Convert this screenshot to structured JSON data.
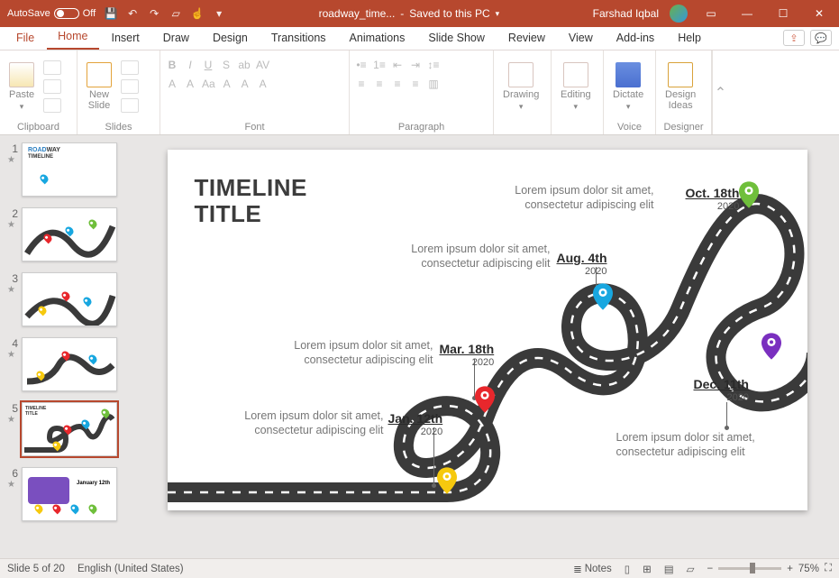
{
  "titlebar": {
    "autosave_label": "AutoSave",
    "autosave_state": "Off",
    "filename": "roadway_time...",
    "save_status": "Saved to this PC",
    "user_name": "Farshad Iqbal"
  },
  "tabs": {
    "file": "File",
    "home": "Home",
    "insert": "Insert",
    "draw": "Draw",
    "design": "Design",
    "transitions": "Transitions",
    "animations": "Animations",
    "slideshow": "Slide Show",
    "review": "Review",
    "view": "View",
    "addins": "Add-ins",
    "help": "Help"
  },
  "ribbon": {
    "paste": "Paste",
    "new_slide": "New\nSlide",
    "drawing": "Drawing",
    "editing": "Editing",
    "dictate": "Dictate",
    "design_ideas": "Design\nIdeas",
    "groups": {
      "clipboard": "Clipboard",
      "slides": "Slides",
      "font": "Font",
      "paragraph": "Paragraph",
      "voice": "Voice",
      "designer": "Designer"
    },
    "font_letters": [
      "B",
      "I",
      "U",
      "S",
      "ab",
      "AV"
    ],
    "font_row2": [
      "A",
      "A",
      "Aa",
      "A",
      "A",
      "A"
    ]
  },
  "slide": {
    "title_line1": "TIMELINE",
    "title_line2": "TITLE",
    "events": [
      {
        "id": "e1",
        "date": "Jan. 12th",
        "year": "2020",
        "desc": "Lorem ipsum dolor sit amet, consectetur adipiscing elit",
        "pin_color": "#F6C90E"
      },
      {
        "id": "e2",
        "date": "Mar. 18th",
        "year": "2020",
        "desc": "Lorem ipsum dolor sit amet, consectetur adipiscing elit",
        "pin_color": "#E8272C"
      },
      {
        "id": "e3",
        "date": "Aug. 4th",
        "year": "2020",
        "desc": "Lorem ipsum dolor sit amet, consectetur adipiscing elit",
        "pin_color": "#18A7E0"
      },
      {
        "id": "e4",
        "date": "Oct. 18th",
        "year": "2020",
        "desc": "Lorem ipsum dolor sit amet, consectetur adipiscing elit",
        "pin_color": "#6FBF3B"
      },
      {
        "id": "e5",
        "date": "Dec. 11th",
        "year": "2020",
        "desc": "Lorem ipsum dolor sit amet, consectetur adipiscing elit",
        "pin_color": "#7A2FBF"
      }
    ]
  },
  "thumbnails": [
    1,
    2,
    3,
    4,
    5,
    6
  ],
  "active_thumbnail": 5,
  "statusbar": {
    "slide_pos": "Slide 5 of 20",
    "language": "English (United States)",
    "notes": "Notes",
    "zoom": "75%"
  }
}
